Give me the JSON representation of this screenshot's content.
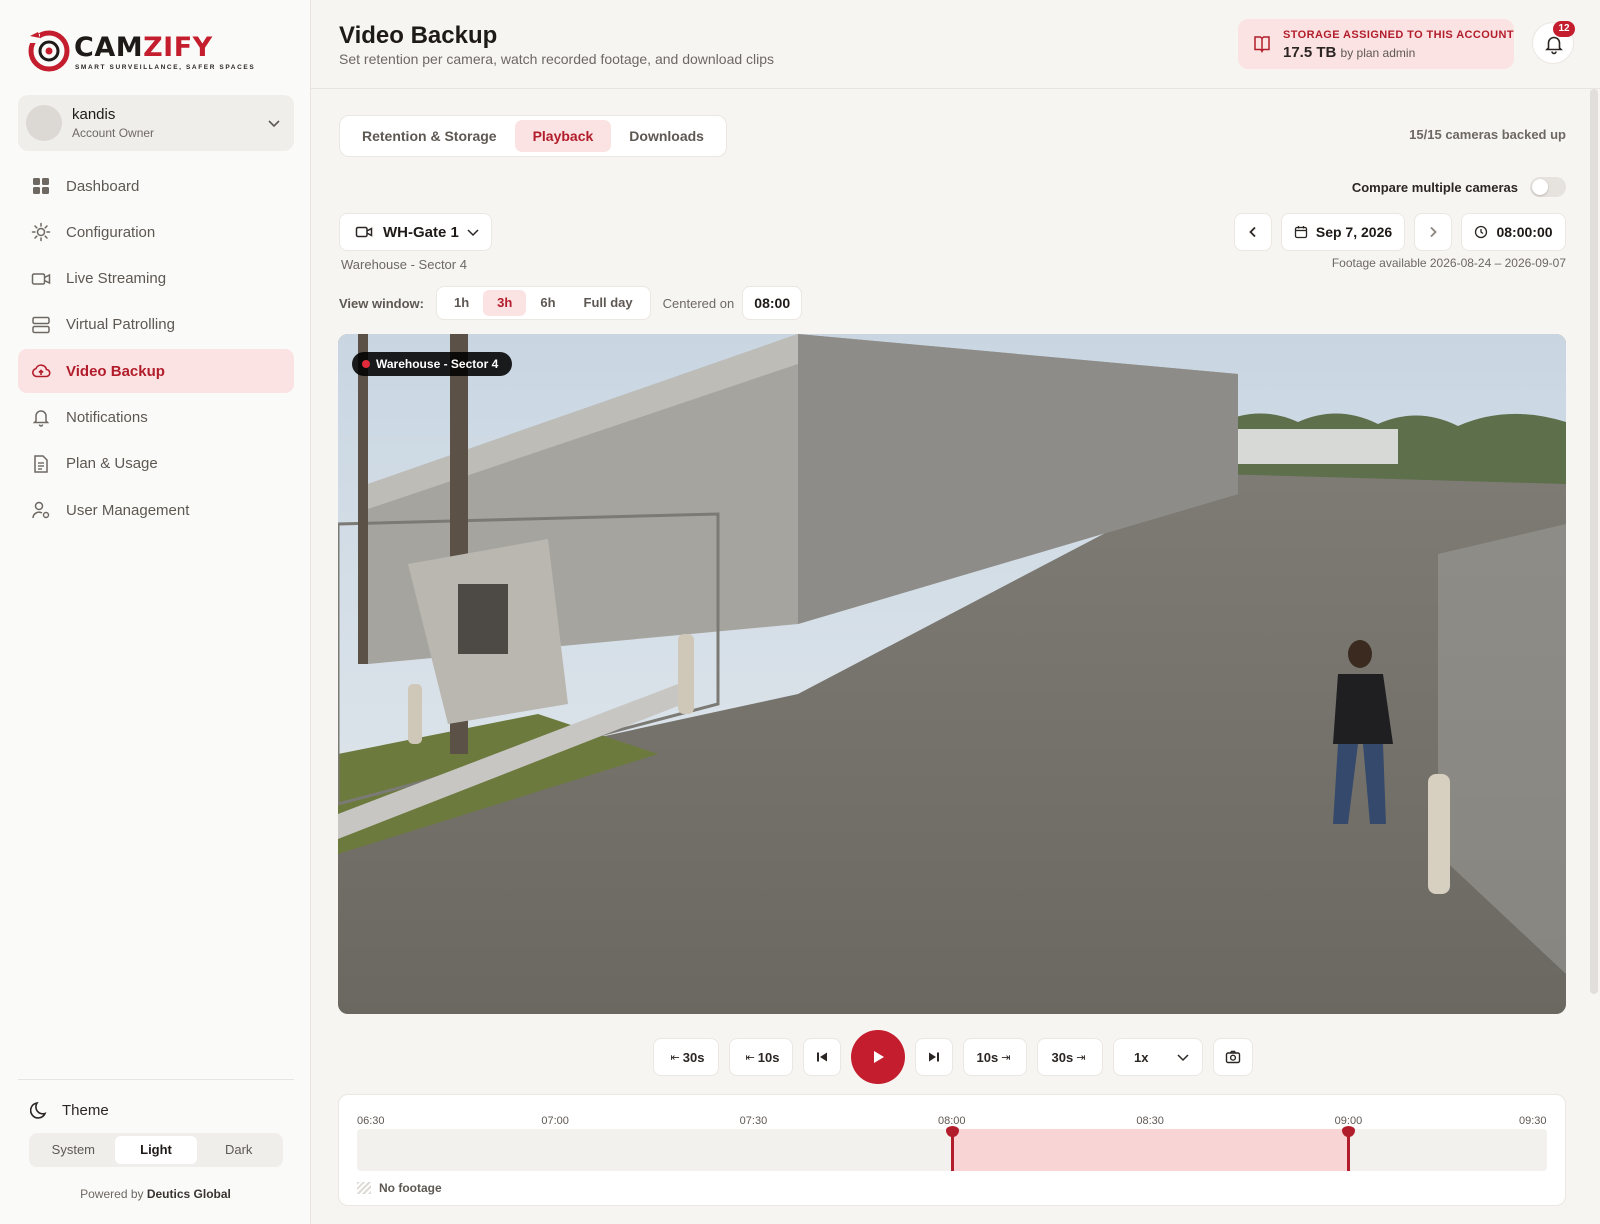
{
  "brand": {
    "name_a": "CAM",
    "name_b": "ZIFY",
    "tagline": "SMART SURVEILLANCE, SAFER SPACES"
  },
  "account": {
    "name": "kandis",
    "role": "Account Owner"
  },
  "nav": [
    {
      "label": "Dashboard",
      "icon": "dashboard-grid-icon"
    },
    {
      "label": "Configuration",
      "icon": "gear-icon"
    },
    {
      "label": "Live Streaming",
      "icon": "video-camera-icon"
    },
    {
      "label": "Virtual Patrolling",
      "icon": "server-icon"
    },
    {
      "label": "Video Backup",
      "icon": "cloud-upload-icon",
      "active": true
    },
    {
      "label": "Notifications",
      "icon": "bell-icon"
    },
    {
      "label": "Plan & Usage",
      "icon": "document-icon"
    },
    {
      "label": "User Management",
      "icon": "user-gear-icon"
    }
  ],
  "theme": {
    "label": "Theme",
    "options": [
      "System",
      "Light",
      "Dark"
    ],
    "selected": "Light"
  },
  "powered": {
    "prefix": "Powered by",
    "company": "Deutics Global"
  },
  "header": {
    "title": "Video Backup",
    "subtitle": "Set retention per camera, watch recorded footage, and download clips",
    "storage_label": "STORAGE ASSIGNED TO THIS ACCOUNT",
    "storage_value": "17.5 TB",
    "storage_suffix": "by plan admin",
    "notification_count": "12"
  },
  "tabs": [
    "Retention & Storage",
    "Playback",
    "Downloads"
  ],
  "active_tab": "Playback",
  "backed_up": "15/15 cameras backed up",
  "compare_label": "Compare multiple cameras",
  "compare_enabled": false,
  "camera": {
    "name": "WH-Gate 1",
    "location": "Warehouse - Sector 4",
    "overlay": "Warehouse - Sector 4"
  },
  "date": {
    "value": "Sep 7, 2026",
    "time": "08:00:00",
    "available": "Footage available 2026-08-24 – 2026-09-07"
  },
  "view_window": {
    "label": "View window:",
    "options": [
      "1h",
      "3h",
      "6h",
      "Full day"
    ],
    "selected": "3h",
    "centered_label": "Centered on",
    "centered_value": "08:00"
  },
  "controls": {
    "back30": "30s",
    "back10": "10s",
    "fwd10": "10s",
    "fwd30": "30s",
    "speed": "1x",
    "back_arrow": "⇤",
    "fwd_arrow": "⇥"
  },
  "timeline": {
    "ticks": [
      "06:30",
      "07:00",
      "07:30",
      "08:00",
      "08:30",
      "09:00",
      "09:30"
    ],
    "footage_start": "08:00",
    "footage_end": "09:00",
    "legend_no_footage": "No footage"
  },
  "colors": {
    "accent": "#c41e2e",
    "accent_soft": "#fbe3e3",
    "footage": "#f8d4d5"
  }
}
